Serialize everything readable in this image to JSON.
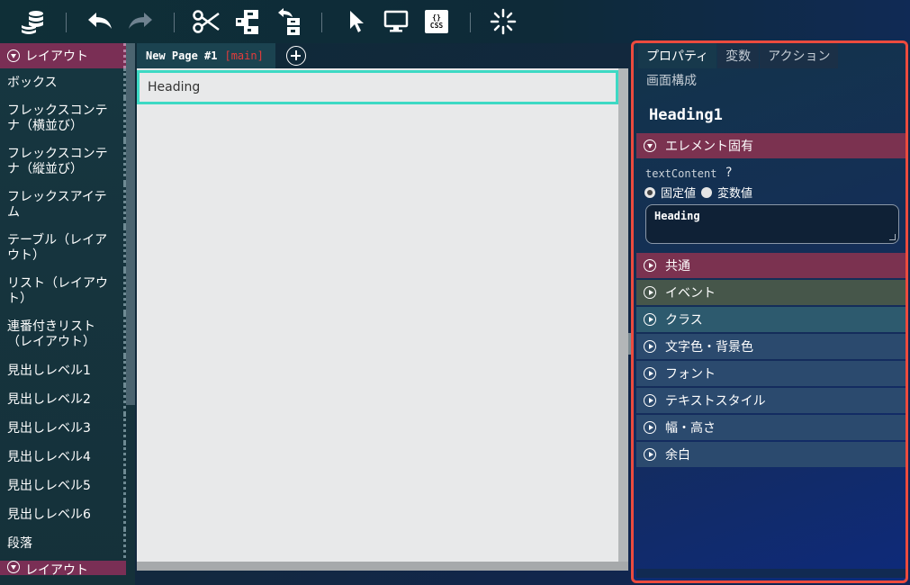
{
  "toolbar": {
    "buttons": [
      {
        "name": "database-icon"
      },
      {
        "name": "undo-icon"
      },
      {
        "name": "redo-icon"
      },
      {
        "name": "cut-icon"
      },
      {
        "name": "layout-tree-icon"
      },
      {
        "name": "export-tree-icon"
      },
      {
        "name": "pointer-icon"
      },
      {
        "name": "monitor-icon"
      },
      {
        "name": "css-icon",
        "label": "CSS",
        "braces": "{}"
      },
      {
        "name": "loading-icon"
      }
    ]
  },
  "palette": {
    "header": "レイアウト",
    "items": [
      "ボックス",
      "フレックスコンテナ（横並び）",
      "フレックスコンテナ（縦並び）",
      "フレックスアイテム",
      "テーブル（レイアウト）",
      "リスト（レイアウト）",
      "連番付きリスト（レイアウト）",
      "見出しレベル1",
      "見出しレベル2",
      "見出しレベル3",
      "見出しレベル4",
      "見出しレベル5",
      "見出しレベル6",
      "段落"
    ],
    "bottom_header": "レイアウト"
  },
  "page_tab": {
    "title": "New Page #1",
    "branch": "[main]"
  },
  "canvas": {
    "heading_text": "Heading"
  },
  "properties": {
    "tabs": [
      "プロパティ",
      "変数",
      "アクション"
    ],
    "active_tab": "プロパティ",
    "second_tab": "画面構成",
    "element_name": "Heading1",
    "sections": [
      {
        "label": "エレメント固有",
        "color": "#7b3250",
        "expanded": true
      },
      {
        "label": "共通",
        "color": "#7b3250"
      },
      {
        "label": "イベント",
        "color": "#46564a"
      },
      {
        "label": "クラス",
        "color": "#2d5a6e"
      },
      {
        "label": "文字色・背景色",
        "color": "#2b4a6e"
      },
      {
        "label": "フォント",
        "color": "#2b4a6e"
      },
      {
        "label": "テキストスタイル",
        "color": "#2b4a6e"
      },
      {
        "label": "幅・高さ",
        "color": "#2b4a6e"
      },
      {
        "label": "余白",
        "color": "#2b4a6e"
      }
    ],
    "field_label": "textContent",
    "help": "?",
    "radio_fixed": "固定値",
    "radio_variable": "変数値",
    "radio_selected": "固定値",
    "text_value": "Heading"
  },
  "colors": {
    "accent_teal": "#3dd9c4",
    "highlight_red": "#ec4b3e",
    "section_magenta": "#7b3250"
  }
}
